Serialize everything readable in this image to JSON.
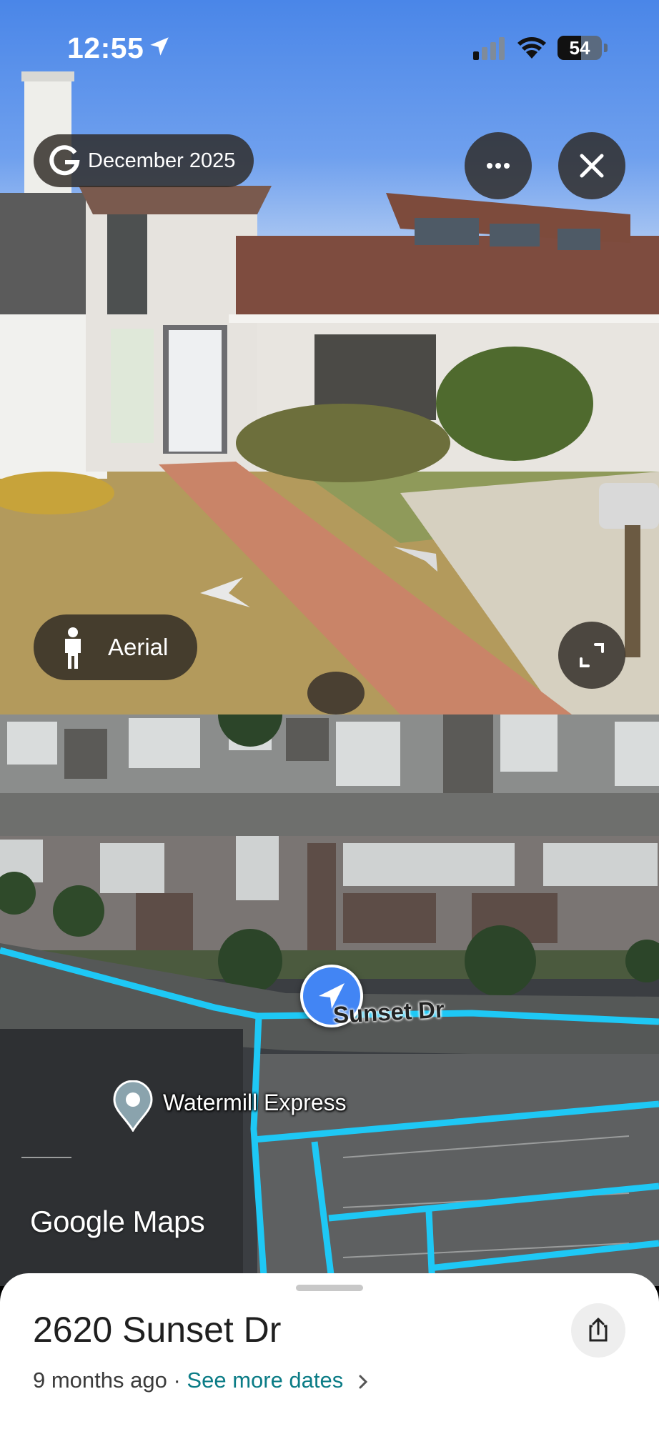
{
  "status_bar": {
    "time": "12:55",
    "battery_percent": "54",
    "battery_level": 0.54,
    "icons": [
      "location-arrow-icon",
      "cellular-signal-icon",
      "wifi-icon",
      "battery-icon"
    ]
  },
  "street_view": {
    "capture_date": "December 2025",
    "aerial_label": "Aerial",
    "icons": [
      "google-g-icon",
      "more-icon",
      "close-icon",
      "person-icon",
      "expand-icon"
    ]
  },
  "map": {
    "street_label": "Sunset Dr",
    "place_label": "Watermill Express",
    "watermark": "Google Maps",
    "accent_color": "#1ec8f5",
    "icons": [
      "navigation-arrow-icon",
      "place-pin-icon"
    ]
  },
  "bottom_sheet": {
    "address": "2620 Sunset Dr",
    "age": "9 months ago",
    "separator": " · ",
    "dates_link": "See more dates",
    "icons": [
      "chevron-right-icon",
      "share-icon"
    ]
  }
}
